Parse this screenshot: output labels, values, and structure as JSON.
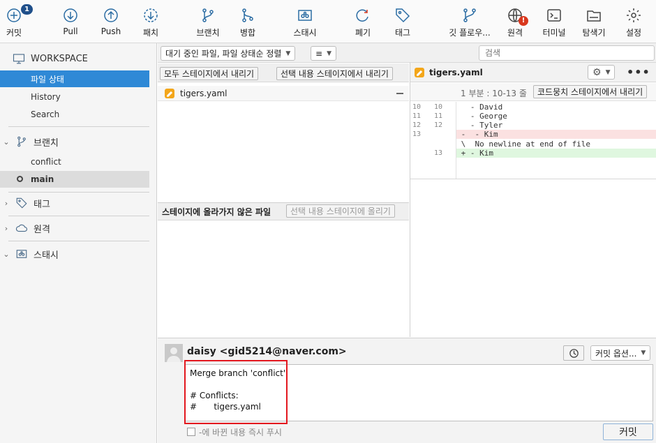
{
  "toolbar": {
    "commit": {
      "label": "커밋",
      "badge": "1"
    },
    "pull": {
      "label": "Pull"
    },
    "push": {
      "label": "Push"
    },
    "fetch": {
      "label": "패치"
    },
    "branch": {
      "label": "브랜치"
    },
    "merge": {
      "label": "병합"
    },
    "stash": {
      "label": "스태시"
    },
    "discard": {
      "label": "폐기"
    },
    "tag": {
      "label": "태그"
    },
    "gitflow": {
      "label": "깃 플로우..."
    },
    "remote": {
      "label": "원격",
      "alert": "!"
    },
    "terminal": {
      "label": "터미널"
    },
    "explorer": {
      "label": "탐색기"
    },
    "settings": {
      "label": "설정"
    }
  },
  "sidebar": {
    "workspace": "WORKSPACE",
    "file_status": "파일 상태",
    "history": "History",
    "search": "Search",
    "branches": "브랜치",
    "branch_items": [
      "conflict",
      "main"
    ],
    "tags": "태그",
    "remotes": "원격",
    "stashes": "스태시"
  },
  "filter": {
    "sort": "대기 중인 파일, 파일 상태순 정렬",
    "list_icon": "≡",
    "search_placeholder": "검색"
  },
  "staged": {
    "unstage_all": "모두 스테이지에서 내리기",
    "unstage_selected": "선택 내용 스테이지에서 내리기",
    "files": [
      "tigers.yaml"
    ]
  },
  "unstaged": {
    "title": "스테이지에 올라가지 않은 파일",
    "stage_selected": "선택 내용 스테이지에 올리기"
  },
  "diff": {
    "filename": "tigers.yaml",
    "hunk": "1 부분 : 10-13 줄",
    "unstage_hunk": "코드뭉치 스테이지에서 내리기",
    "lines": [
      {
        "old": "10",
        "new": "10",
        "text": "   - David",
        "kind": "ctx"
      },
      {
        "old": "11",
        "new": "11",
        "text": "   - George",
        "kind": "ctx"
      },
      {
        "old": "12",
        "new": "12",
        "text": "   - Tyler",
        "kind": "ctx"
      },
      {
        "old": "13",
        "new": "",
        "text": " -  - Kim",
        "kind": "del"
      },
      {
        "old": "",
        "new": "",
        "text": " \\  No newline at end of file",
        "kind": "ctx"
      },
      {
        "old": "",
        "new": "13",
        "text": " + - Kim",
        "kind": "add"
      }
    ]
  },
  "commit": {
    "author": "daisy <gid5214@naver.com>",
    "options": "커밋 옵션...",
    "message": "Merge branch 'conflict'\n\n# Conflicts:\n#\t tigers.yaml",
    "push_immediately": "-에 바뀐 내용 즉시 푸시",
    "commit_button": "커밋"
  },
  "colors": {
    "selection": "#2f89d6",
    "highlight": "#e3171e",
    "icon": "#2b6ca3"
  }
}
